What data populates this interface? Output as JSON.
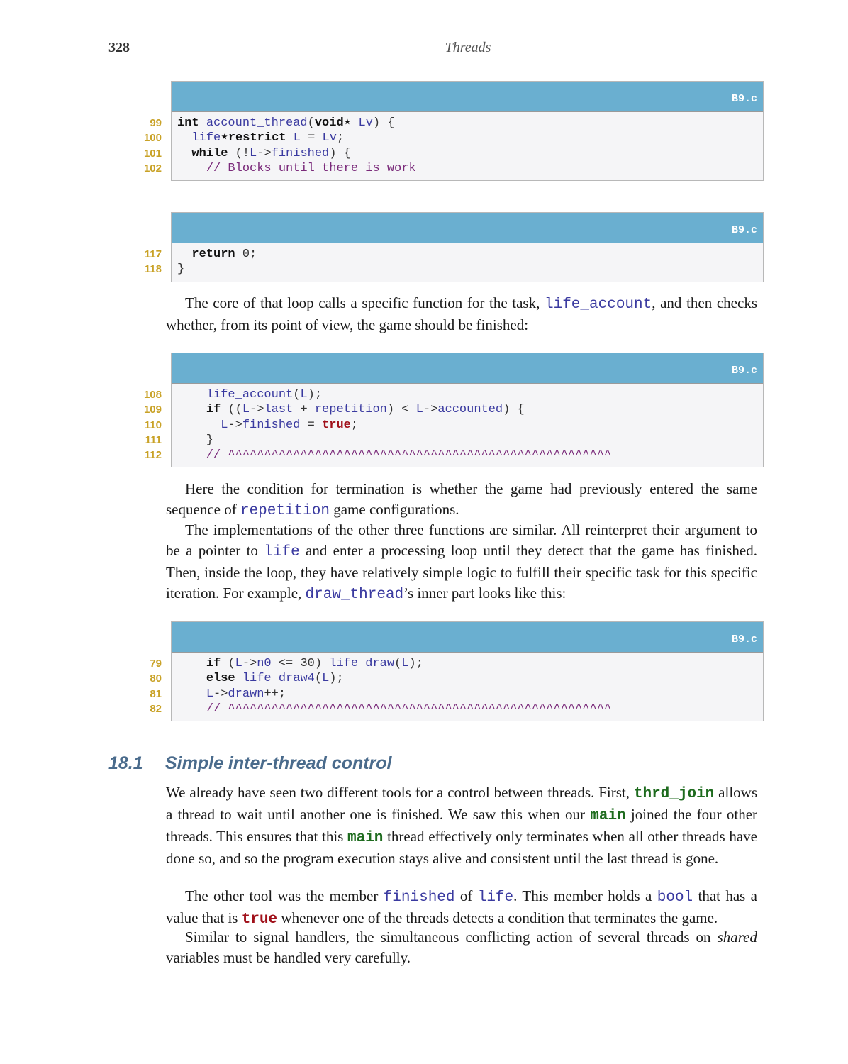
{
  "header": {
    "page_number": "328",
    "running_head": "Threads"
  },
  "listings": [
    {
      "filename": "B9.c",
      "lines": [
        {
          "no": "99",
          "tokens": [
            [
              "kw",
              "int"
            ],
            [
              "op",
              " "
            ],
            [
              "id",
              "account_thread"
            ],
            [
              "op",
              "("
            ],
            [
              "kw",
              "void"
            ],
            [
              "kw",
              "⋆"
            ],
            [
              "op",
              " "
            ],
            [
              "id",
              "Lv"
            ],
            [
              "op",
              ") {"
            ]
          ]
        },
        {
          "no": "100",
          "tokens": [
            [
              "op",
              "  "
            ],
            [
              "id",
              "life"
            ],
            [
              "kw",
              "⋆restrict"
            ],
            [
              "op",
              " "
            ],
            [
              "id",
              "L"
            ],
            [
              "op",
              " = "
            ],
            [
              "id",
              "Lv"
            ],
            [
              "op",
              ";"
            ]
          ]
        },
        {
          "no": "101",
          "tokens": [
            [
              "op",
              "  "
            ],
            [
              "kw",
              "while"
            ],
            [
              "op",
              " (!"
            ],
            [
              "id",
              "L"
            ],
            [
              "op",
              "->"
            ],
            [
              "id",
              "finished"
            ],
            [
              "op",
              ") {"
            ]
          ]
        },
        {
          "no": "102",
          "tokens": [
            [
              "op",
              "    "
            ],
            [
              "cm",
              "// Blocks until there is work"
            ]
          ]
        }
      ]
    },
    {
      "filename": "B9.c",
      "lines": [
        {
          "no": "117",
          "tokens": [
            [
              "op",
              "  "
            ],
            [
              "kw",
              "return"
            ],
            [
              "op",
              " 0;"
            ]
          ]
        },
        {
          "no": "118",
          "tokens": [
            [
              "op",
              "}"
            ]
          ]
        }
      ]
    },
    {
      "filename": "B9.c",
      "lines": [
        {
          "no": "108",
          "tokens": [
            [
              "op",
              "    "
            ],
            [
              "id",
              "life_account"
            ],
            [
              "op",
              "("
            ],
            [
              "id",
              "L"
            ],
            [
              "op",
              ");"
            ]
          ]
        },
        {
          "no": "109",
          "tokens": [
            [
              "op",
              "    "
            ],
            [
              "kw",
              "if"
            ],
            [
              "op",
              " (("
            ],
            [
              "id",
              "L"
            ],
            [
              "op",
              "->"
            ],
            [
              "id",
              "last"
            ],
            [
              "op",
              " + "
            ],
            [
              "id",
              "repetition"
            ],
            [
              "op",
              ") < "
            ],
            [
              "id",
              "L"
            ],
            [
              "op",
              "->"
            ],
            [
              "id",
              "accounted"
            ],
            [
              "op",
              ") {"
            ]
          ]
        },
        {
          "no": "110",
          "tokens": [
            [
              "op",
              "      "
            ],
            [
              "id",
              "L"
            ],
            [
              "op",
              "->"
            ],
            [
              "id",
              "finished"
            ],
            [
              "op",
              " = "
            ],
            [
              "tr",
              "true"
            ],
            [
              "op",
              ";"
            ]
          ]
        },
        {
          "no": "111",
          "tokens": [
            [
              "op",
              "    }"
            ]
          ]
        },
        {
          "no": "112",
          "tokens": [
            [
              "op",
              "    "
            ],
            [
              "cm",
              "// ^^^^^^^^^^^^^^^^^^^^^^^^^^^^^^^^^^^^^^^^^^^^^^^^^^^^^"
            ]
          ]
        }
      ]
    },
    {
      "filename": "B9.c",
      "lines": [
        {
          "no": "79",
          "tokens": [
            [
              "op",
              "    "
            ],
            [
              "kw",
              "if"
            ],
            [
              "op",
              " ("
            ],
            [
              "id",
              "L"
            ],
            [
              "op",
              "->"
            ],
            [
              "id",
              "n0"
            ],
            [
              "op",
              " <= 30) "
            ],
            [
              "id",
              "life_draw"
            ],
            [
              "op",
              "("
            ],
            [
              "id",
              "L"
            ],
            [
              "op",
              ");"
            ]
          ]
        },
        {
          "no": "80",
          "tokens": [
            [
              "op",
              "    "
            ],
            [
              "kw",
              "else"
            ],
            [
              "op",
              " "
            ],
            [
              "id",
              "life_draw4"
            ],
            [
              "op",
              "("
            ],
            [
              "id",
              "L"
            ],
            [
              "op",
              ");"
            ]
          ]
        },
        {
          "no": "81",
          "tokens": [
            [
              "op",
              "    "
            ],
            [
              "id",
              "L"
            ],
            [
              "op",
              "->"
            ],
            [
              "id",
              "drawn"
            ],
            [
              "op",
              "++;"
            ]
          ]
        },
        {
          "no": "82",
          "tokens": [
            [
              "op",
              "    "
            ],
            [
              "cm",
              "// ^^^^^^^^^^^^^^^^^^^^^^^^^^^^^^^^^^^^^^^^^^^^^^^^^^^^^"
            ]
          ]
        }
      ]
    }
  ],
  "paragraphs": {
    "p1": {
      "a": "The core of that loop calls a specific function for the task, ",
      "c1": "life_account",
      "b": ", and then checks whether, from its point of view, the game should be finished:"
    },
    "p2": {
      "a": "Here the condition for termination is whether the game had previously entered the same sequence of ",
      "c1": "repetition",
      "b": " game configurations."
    },
    "p3": {
      "a": "The implementations of the other three functions are similar. All reinterpret their argument to be a pointer to ",
      "c1": "life",
      "b": " and enter a processing loop until they detect that the game has finished. Then, inside the loop, they have relatively simple logic to fulfill their specific task for this specific iteration. For example, ",
      "c2": "draw_thread",
      "c": "’s inner part looks like this:"
    },
    "p4": {
      "a": "We already have seen two different tools for a control between threads. First, ",
      "c1": "thrd_join",
      "b": " allows a thread to wait until another one is finished. We saw this when our ",
      "c2": "main",
      "c": " joined the four other threads. This ensures that this ",
      "c3": "main",
      "d": " thread effectively only terminates when all other threads have done so, and so the program execution stays alive and consistent until the last thread is gone."
    },
    "p5": {
      "a": "The other tool was the member ",
      "c1": "finished",
      "b": " of ",
      "c2": "life",
      "c": ". This member holds a ",
      "c3": "bool",
      "d": " that has a value that is ",
      "c4": "true",
      "e": " whenever one of the threads detects a condition that terminates the game."
    },
    "p6": {
      "a": "Similar to signal handlers, the simultaneous conflicting action of several threads on ",
      "em": "shared",
      "b": " variables must be handled very carefully."
    }
  },
  "section": {
    "number": "18.1",
    "title": "Simple inter-thread control"
  }
}
